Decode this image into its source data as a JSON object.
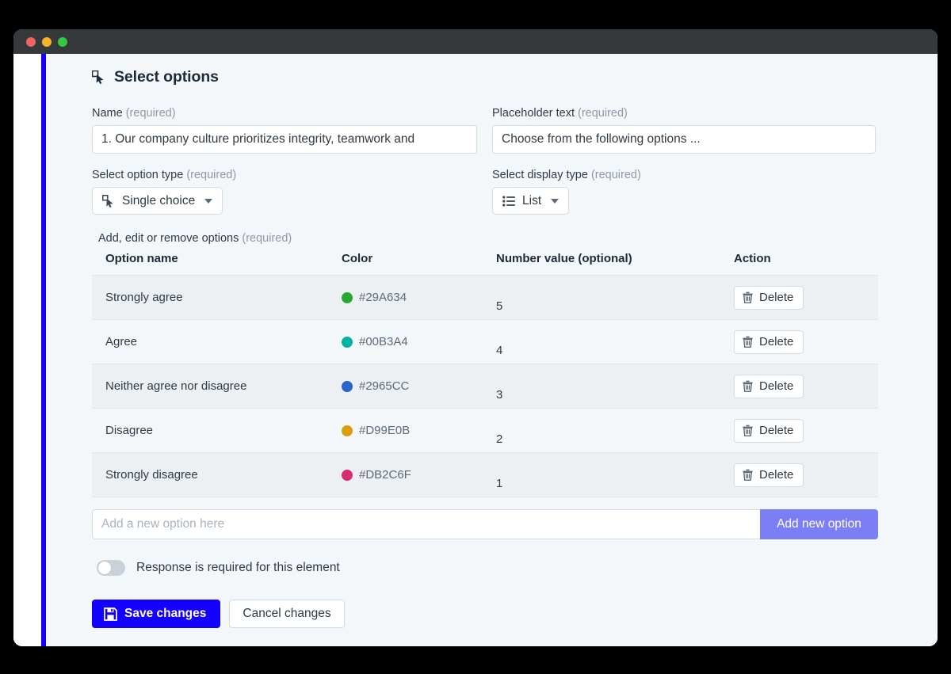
{
  "window": {
    "traffic_lights": [
      "close",
      "minimize",
      "maximize"
    ],
    "accent_rail_color": "#1400ff"
  },
  "section": {
    "icon": "select-pointer-icon",
    "title": "Select options"
  },
  "fields": {
    "name": {
      "label": "Name",
      "required_suffix": "(required)",
      "value": "1. Our company culture prioritizes integrity, teamwork and"
    },
    "placeholder_text": {
      "label": "Placeholder text",
      "required_suffix": "(required)",
      "value": "Choose from the following options ..."
    },
    "option_type": {
      "label": "Select option type",
      "required_suffix": "(required)",
      "selected": "Single choice",
      "icon": "select-pointer-icon"
    },
    "display_type": {
      "label": "Select display type",
      "required_suffix": "(required)",
      "selected": "List",
      "icon": "list-icon"
    }
  },
  "options_table": {
    "label": "Add, edit or remove options",
    "required_suffix": "(required)",
    "headers": {
      "name": "Option name",
      "color": "Color",
      "number": "Number value (optional)",
      "action": "Action"
    },
    "delete_label": "Delete",
    "rows": [
      {
        "name": "Strongly agree",
        "color": "#29A634",
        "color_hex_label": "#29A634",
        "number": "5"
      },
      {
        "name": "Agree",
        "color": "#00B3A4",
        "color_hex_label": "#00B3A4",
        "number": "4"
      },
      {
        "name": "Neither agree nor disagree",
        "color": "#2965CC",
        "color_hex_label": "#2965CC",
        "number": "3"
      },
      {
        "name": "Disagree",
        "color": "#D99E0B",
        "color_hex_label": "#D99E0B",
        "number": "2"
      },
      {
        "name": "Strongly disagree",
        "color": "#DB2C6F",
        "color_hex_label": "#DB2C6F",
        "number": "1"
      }
    ]
  },
  "add_option": {
    "input_placeholder": "Add a new option here",
    "input_value": "",
    "button_label": "Add new option",
    "button_color": "#7b7ef5"
  },
  "required_toggle": {
    "label": "Response is required for this element",
    "state": "off"
  },
  "footer": {
    "save_label": "Save changes",
    "save_icon": "save-floppy-icon",
    "save_color": "#1400ff",
    "cancel_label": "Cancel changes"
  }
}
